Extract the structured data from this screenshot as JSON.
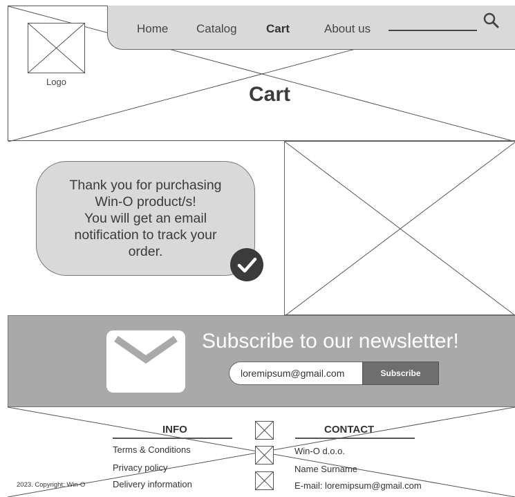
{
  "nav": {
    "items": [
      "Home",
      "Catalog",
      "Cart",
      "About us"
    ],
    "active_index": 2,
    "search_placeholder": "",
    "search_icon": "search-icon"
  },
  "logo": {
    "label": "Logo"
  },
  "page": {
    "title": "Cart"
  },
  "message": {
    "text": "Thank you for purchasing\nWin-O product/s!\nYou will get an email\nnotification to track your\norder.",
    "icon": "check-icon"
  },
  "newsletter": {
    "title": "Subscribe to our newsletter!",
    "email_value": "loremipsum@gmail.com",
    "button_label": "Subscribe",
    "icon": "envelope-icon"
  },
  "footer": {
    "info_title": "INFO",
    "info_links": [
      "Terms & Conditions",
      "Privacy policy",
      "Delivery information"
    ],
    "contact_title": "CONTACT",
    "contact_lines": [
      "Win-O d.o.o.",
      "Name Surname",
      "E-mail: loremipsum@gmail.com"
    ],
    "copyright": "2023. Copyright: Win-O"
  },
  "colors": {
    "panel": "#d9d9d9",
    "newsletter_bg": "#a9a9a9",
    "button": "#6e6e6e",
    "check_bg": "#3b3b3b"
  }
}
